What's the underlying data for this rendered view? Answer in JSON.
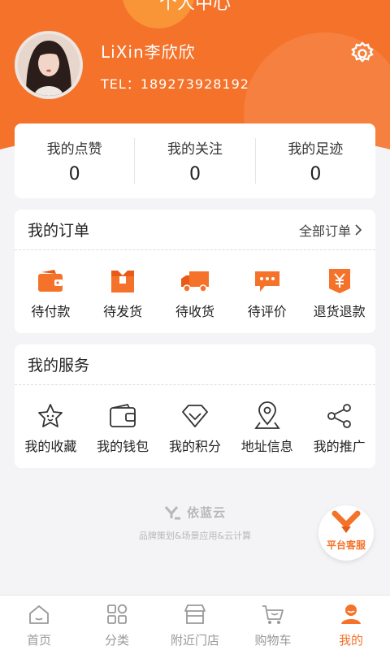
{
  "header": {
    "title": "个人中心",
    "user_name": "LiXin李欣欣",
    "tel_label": "TEL：",
    "tel_value": "18927392819​2"
  },
  "stats": [
    {
      "label": "我的点赞",
      "value": "0"
    },
    {
      "label": "我的关注",
      "value": "0"
    },
    {
      "label": "我的足迹",
      "value": "0"
    }
  ],
  "orders": {
    "title": "我的订单",
    "more": "全部订单",
    "items": [
      {
        "label": "待付款",
        "icon": "wallet-icon"
      },
      {
        "label": "待发货",
        "icon": "package-icon"
      },
      {
        "label": "待收货",
        "icon": "truck-icon"
      },
      {
        "label": "待评价",
        "icon": "comment-icon"
      },
      {
        "label": "退货退款",
        "icon": "refund-icon"
      }
    ]
  },
  "services": {
    "title": "我的服务",
    "items": [
      {
        "label": "我的收藏",
        "icon": "star-icon"
      },
      {
        "label": "我的钱包",
        "icon": "wallet-outline-icon"
      },
      {
        "label": "我的积分",
        "icon": "diamond-icon"
      },
      {
        "label": "地址信息",
        "icon": "location-icon"
      },
      {
        "label": "我的推广",
        "icon": "share-icon"
      }
    ]
  },
  "brand": {
    "logo": "依蓝云",
    "slogan": "品牌策划&场景应用&云计算"
  },
  "customer_service": {
    "label": "平台客服"
  },
  "tabbar": [
    {
      "label": "首页",
      "icon": "home-icon",
      "active": false
    },
    {
      "label": "分类",
      "icon": "category-icon",
      "active": false
    },
    {
      "label": "附近门店",
      "icon": "store-icon",
      "active": false
    },
    {
      "label": "购物车",
      "icon": "cart-icon",
      "active": false
    },
    {
      "label": "我的",
      "icon": "profile-icon",
      "active": true
    }
  ],
  "colors": {
    "accent": "#f5722a",
    "background": "#f4f4f6"
  }
}
